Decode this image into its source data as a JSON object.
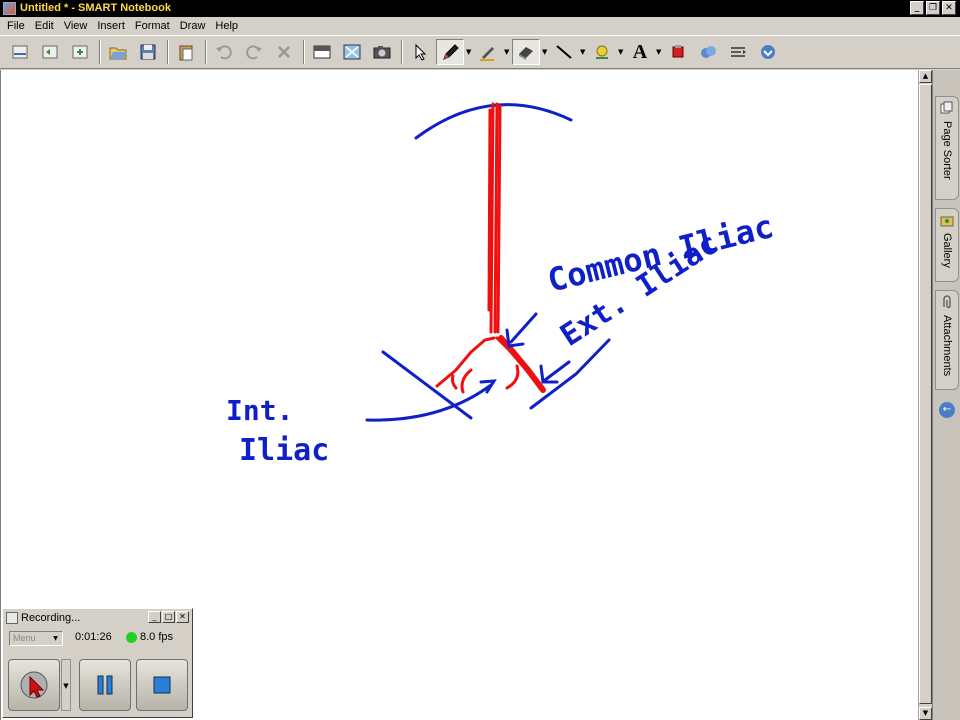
{
  "window": {
    "title": "Untitled * - SMART Notebook",
    "min_glyph": "_",
    "restore_glyph": "❐",
    "close_glyph": "✕"
  },
  "menu": {
    "items": [
      "File",
      "Edit",
      "View",
      "Insert",
      "Format",
      "Draw",
      "Help"
    ]
  },
  "toolbar": {
    "icons": [
      "prev-page-icon",
      "next-page-icon",
      "add-page-icon",
      "open-icon",
      "save-icon",
      "paste-icon",
      "undo-icon",
      "redo-icon",
      "delete-icon",
      "screen-shade-icon",
      "full-screen-icon",
      "capture-icon",
      "select-icon",
      "pen-icon",
      "creative-pen-icon",
      "eraser-icon",
      "line-icon",
      "fill-icon",
      "text-icon",
      "shapes-icon",
      "table-icon",
      "properties-icon",
      "more-icon"
    ],
    "active_tool": "pen-icon",
    "text_tool_glyph": "A"
  },
  "canvas": {
    "annotations": {
      "common_iliac": "Common Iliac",
      "ext_iliac": "Ext. Iliac",
      "int_line1": "Int.",
      "int_line2": "Iliac"
    },
    "colors": {
      "ink_blue": "#1020c8",
      "ink_red": "#ee1010"
    }
  },
  "side_tabs": {
    "items": [
      {
        "label": "Page Sorter",
        "icon": "page-sorter-icon"
      },
      {
        "label": "Gallery",
        "icon": "gallery-icon"
      },
      {
        "label": "Attachments",
        "icon": "attachments-icon"
      }
    ],
    "collapse_glyph": "←"
  },
  "recorder": {
    "title": "Recording...",
    "time": "0:01:26",
    "fps": "8.0 fps",
    "mode": "Menu",
    "status_color": "#22d020"
  }
}
